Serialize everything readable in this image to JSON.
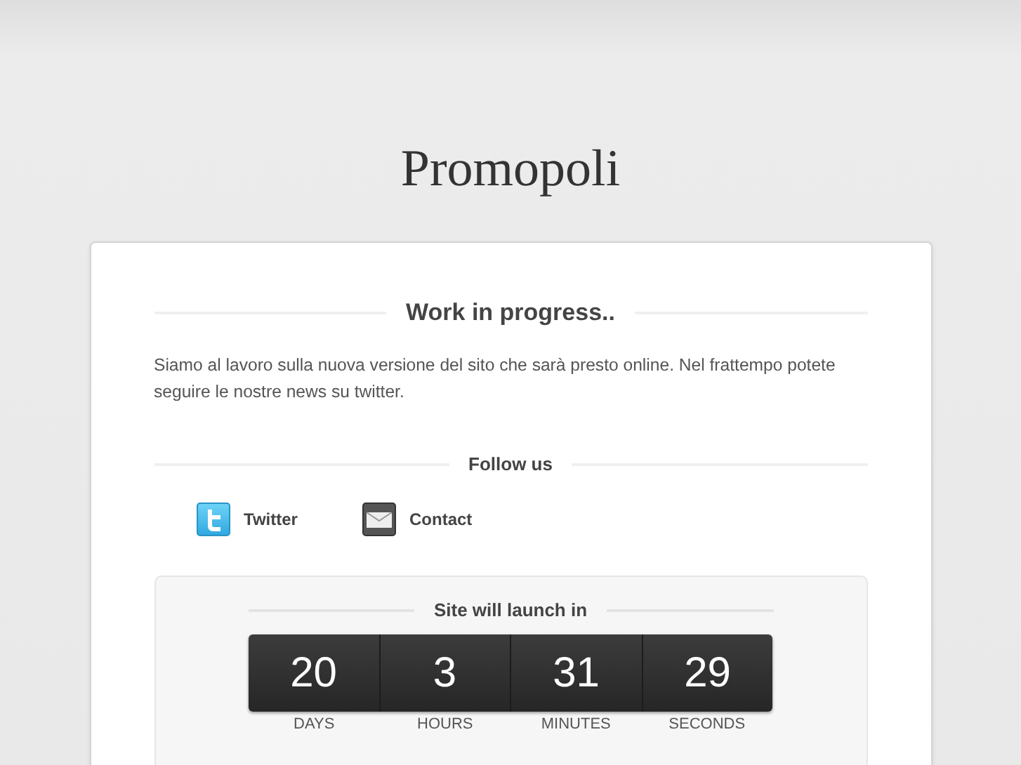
{
  "site_title": "Promopoli",
  "heading": "Work in progress..",
  "message": "Siamo al lavoro sulla nuova versione del sito che sarà presto online. Nel frattempo potete seguire le nostre news su twitter.",
  "follow_heading": "Follow us",
  "links": [
    {
      "kind": "twitter",
      "label": "Twitter"
    },
    {
      "kind": "contact",
      "label": "Contact"
    }
  ],
  "countdown": {
    "title": "Site will launch in",
    "units": [
      {
        "value": "20",
        "label": "DAYS"
      },
      {
        "value": "3",
        "label": "HOURS"
      },
      {
        "value": "31",
        "label": "MINUTES"
      },
      {
        "value": "29",
        "label": "SECONDS"
      }
    ]
  }
}
